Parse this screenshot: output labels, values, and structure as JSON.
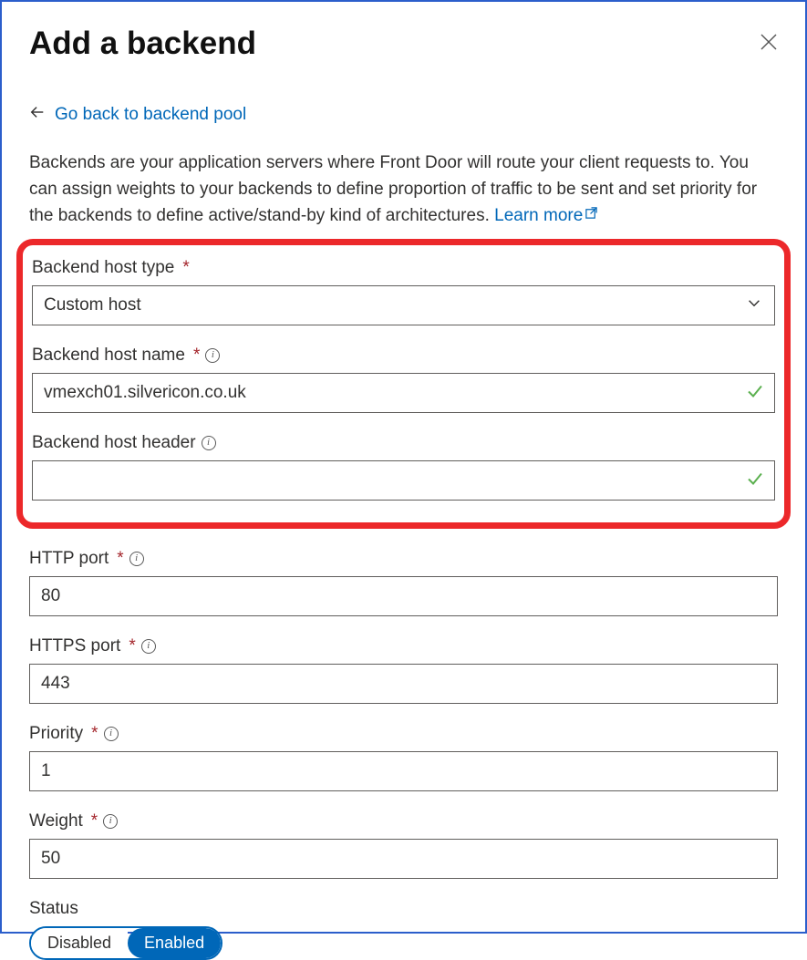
{
  "header": {
    "title": "Add a backend"
  },
  "back": {
    "label": "Go back to backend pool"
  },
  "intro": {
    "text": "Backends are your application servers where Front Door will route your client requests to. You can assign weights to your backends to define proportion of traffic to be sent and set priority for the backends to define active/stand-by kind of architectures. ",
    "learn_more": "Learn more"
  },
  "fields": {
    "host_type": {
      "label": "Backend host type",
      "required": true,
      "value": "Custom host"
    },
    "host_name": {
      "label": "Backend host name",
      "required": true,
      "info": true,
      "value": "vmexch01.silvericon.co.uk",
      "valid": true
    },
    "host_header": {
      "label": "Backend host header",
      "required": false,
      "info": true,
      "value": "",
      "valid": true
    },
    "http_port": {
      "label": "HTTP port",
      "required": true,
      "info": true,
      "value": "80"
    },
    "https_port": {
      "label": "HTTPS port",
      "required": true,
      "info": true,
      "value": "443"
    },
    "priority": {
      "label": "Priority",
      "required": true,
      "info": true,
      "value": "1"
    },
    "weight": {
      "label": "Weight",
      "required": true,
      "info": true,
      "value": "50"
    },
    "status": {
      "label": "Status",
      "options": {
        "off": "Disabled",
        "on": "Enabled"
      },
      "value": "Enabled"
    }
  }
}
